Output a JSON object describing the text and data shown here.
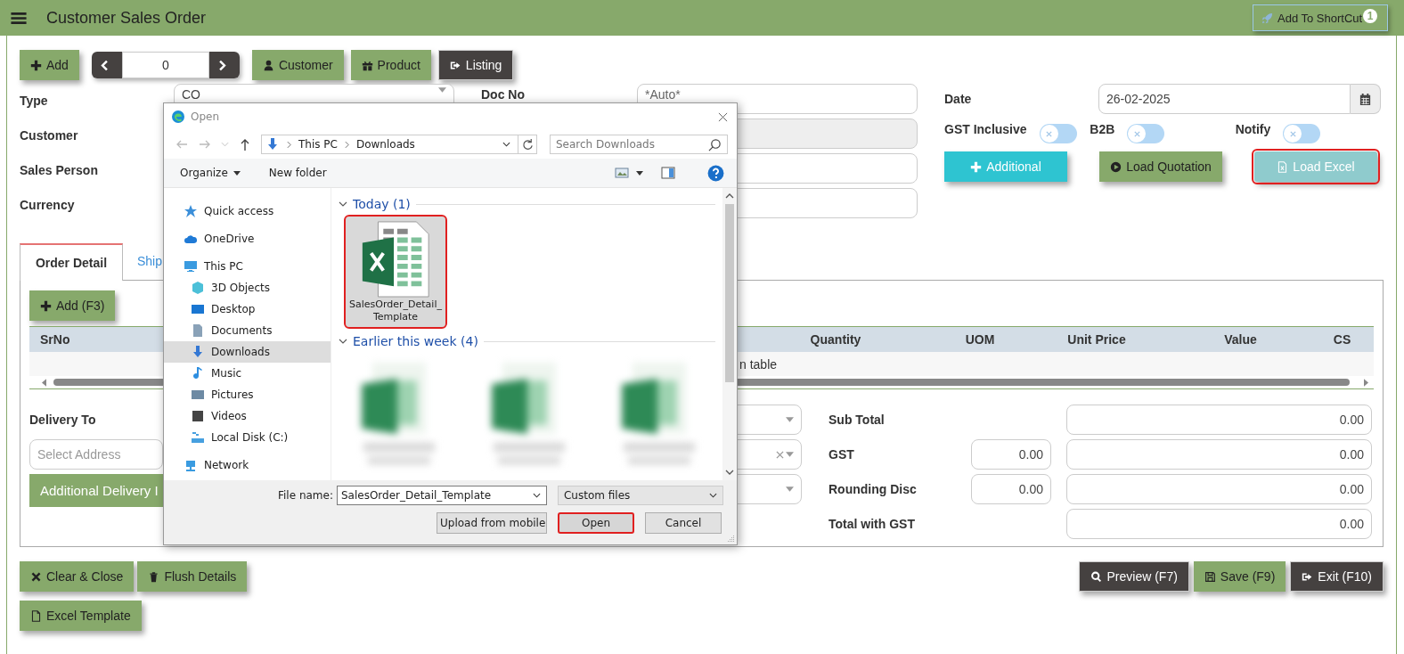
{
  "header": {
    "title": "Customer Sales Order",
    "shortcut_button": "Add To ShortCut",
    "shortcut_badge": "1"
  },
  "toolbar": {
    "add": "Add",
    "pager_value": "0",
    "buttons": [
      {
        "label": "Customer",
        "kind": "user",
        "dark": false
      },
      {
        "label": "Product",
        "kind": "gift",
        "dark": false
      },
      {
        "label": "Listing",
        "kind": "exit",
        "dark": true
      }
    ]
  },
  "form": {
    "type_label": "Type",
    "type_value": "CO",
    "doc_no_label": "Doc No",
    "doc_no_value": "*Auto*",
    "customer_label": "Customer",
    "sales_person_label": "Sales Person",
    "currency_label": "Currency",
    "date_label": "Date",
    "date_value": "26-02-2025",
    "toggles": [
      {
        "label": "GST Inclusive",
        "on": false
      },
      {
        "label": "B2B",
        "on": false
      },
      {
        "label": "Notify",
        "on": false
      }
    ],
    "actions": [
      {
        "label": "Additional",
        "kind": "additional",
        "highlighted": false
      },
      {
        "label": "Load Quotation",
        "kind": "quotation",
        "highlighted": false
      },
      {
        "label": "Load Excel",
        "kind": "excel",
        "highlighted": true
      }
    ]
  },
  "tabs": [
    {
      "label": "Order Detail",
      "selected": true
    },
    {
      "label": "Ship",
      "selected": false
    }
  ],
  "detail": {
    "add_button": "Add (F3)",
    "columns": [
      "SrNo",
      "Quantity",
      "UOM",
      "Unit Price",
      "Value",
      "CS"
    ],
    "empty_text": "n table",
    "delivery_label": "Delivery To",
    "address_placeholder": "Select Address",
    "additional_delivery": "Additional Delivery I",
    "selects": [
      {
        "clearable": false
      },
      {
        "clearable": true
      },
      {
        "clearable": false
      }
    ],
    "totals": [
      {
        "label": "Sub Total",
        "value": "0.00"
      },
      {
        "label": "GST",
        "rate": "0.00",
        "value": "0.00"
      },
      {
        "label": "Rounding Disc",
        "rate": "0.00",
        "value": "0.00"
      },
      {
        "label": "Total with GST",
        "value": "0.00"
      }
    ]
  },
  "footer": {
    "left": [
      {
        "label": "Clear & Close",
        "kind": "times"
      },
      {
        "label": "Flush Details",
        "kind": "trash"
      },
      {
        "label": "Excel Template",
        "kind": "file"
      }
    ],
    "right": [
      {
        "label": "Preview (F7)",
        "kind": "search",
        "dark": true
      },
      {
        "label": "Save (F9)",
        "kind": "save",
        "dark": false
      },
      {
        "label": "Exit (F10)",
        "kind": "exit",
        "dark": true
      }
    ]
  },
  "dialog": {
    "title": "Open",
    "path": [
      "This PC",
      "Downloads"
    ],
    "search_placeholder": "Search Downloads",
    "organize": "Organize",
    "new_folder": "New folder",
    "nav": [
      {
        "label": "Quick access",
        "kind": "star",
        "selected": false
      },
      {
        "label": "OneDrive",
        "kind": "cloud",
        "selected": false
      },
      {
        "label": "This PC",
        "kind": "pc",
        "selected": false,
        "children": [
          {
            "label": "3D Objects",
            "kind": "cube",
            "selected": false
          },
          {
            "label": "Desktop",
            "kind": "desktop",
            "selected": false
          },
          {
            "label": "Documents",
            "kind": "docs",
            "selected": false
          },
          {
            "label": "Downloads",
            "kind": "download",
            "selected": true
          },
          {
            "label": "Music",
            "kind": "music",
            "selected": false
          },
          {
            "label": "Pictures",
            "kind": "pictures",
            "selected": false
          },
          {
            "label": "Videos",
            "kind": "videos",
            "selected": false
          },
          {
            "label": "Local Disk (C:)",
            "kind": "disk",
            "selected": false
          }
        ]
      },
      {
        "label": "Network",
        "kind": "network",
        "selected": false
      }
    ],
    "groups": [
      {
        "title": "Today (1)",
        "files": [
          {
            "name": "SalesOrder_Detail_Template",
            "kind": "excel",
            "selected": true
          }
        ]
      },
      {
        "title": "Earlier this week (4)",
        "files": [
          {
            "kind": "blurred",
            "selected": false
          },
          {
            "kind": "blurred",
            "selected": false
          },
          {
            "kind": "blurred",
            "selected": false
          }
        ]
      }
    ],
    "file_name_label": "File name:",
    "file_name": "SalesOrder_Detail_Template",
    "file_type": "Custom files",
    "buttons": [
      {
        "label": "Upload from mobile",
        "highlighted": false
      },
      {
        "label": "Open",
        "highlighted": true
      },
      {
        "label": "Cancel",
        "highlighted": false
      }
    ]
  }
}
